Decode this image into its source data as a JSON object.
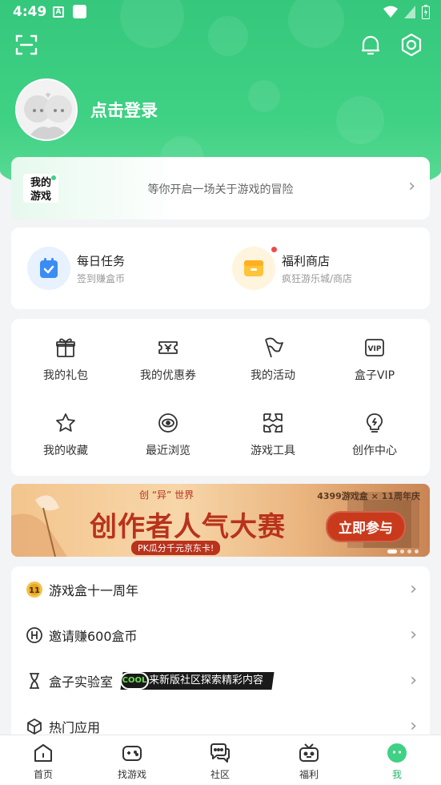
{
  "status_bar": {
    "time": "4:49",
    "notif_letter": "A"
  },
  "header": {
    "login_text": "点击登录"
  },
  "my_game": {
    "logo_text_1": "我的",
    "logo_text_2": "游戏",
    "tagline": "等你开启一场关于游戏的冒险"
  },
  "quick": [
    {
      "title": "每日任务",
      "sub": "签到赚盒币",
      "icon": "calendar-check-icon"
    },
    {
      "title": "福利商店",
      "sub": "疯狂游乐城/商店",
      "icon": "shop-icon"
    }
  ],
  "grid": [
    {
      "label": "我的礼包",
      "icon": "gift-icon"
    },
    {
      "label": "我的优惠券",
      "icon": "coupon-icon"
    },
    {
      "label": "我的活动",
      "icon": "flag-icon"
    },
    {
      "label": "盒子VIP",
      "icon": "vip-icon"
    },
    {
      "label": "我的收藏",
      "icon": "star-icon"
    },
    {
      "label": "最近浏览",
      "icon": "eye-icon"
    },
    {
      "label": "游戏工具",
      "icon": "tools-icon"
    },
    {
      "label": "创作中心",
      "icon": "bulb-icon"
    }
  ],
  "banner": {
    "top_text": "创 “异” 世界",
    "title": "创作者人气大赛",
    "sub": "PK瓜分千元京东卡!",
    "button": "立即参与",
    "brand": "4399游戏盒 × 11周年庆"
  },
  "list": [
    {
      "label": "游戏盒十一周年",
      "icon": "anniversary-11-icon"
    },
    {
      "label": "邀请赚600盒币",
      "icon": "coin-h-icon"
    },
    {
      "label": "盒子实验室",
      "icon": "flask-icon",
      "tag_badge": "COOL",
      "tag": "来新版社区探索精彩内容"
    },
    {
      "label": "热门应用",
      "icon": "cube-icon"
    }
  ],
  "tabs": [
    {
      "label": "首页",
      "icon": "home-icon"
    },
    {
      "label": "找游戏",
      "icon": "gamepad-icon"
    },
    {
      "label": "社区",
      "icon": "chat-icon"
    },
    {
      "label": "福利",
      "icon": "tv-gift-icon"
    },
    {
      "label": "我",
      "icon": "me-face-icon",
      "active": true
    }
  ],
  "colors": {
    "brand_green": "#3fd184",
    "active_tab": "#27b76a",
    "banner_red": "#b8321c"
  }
}
